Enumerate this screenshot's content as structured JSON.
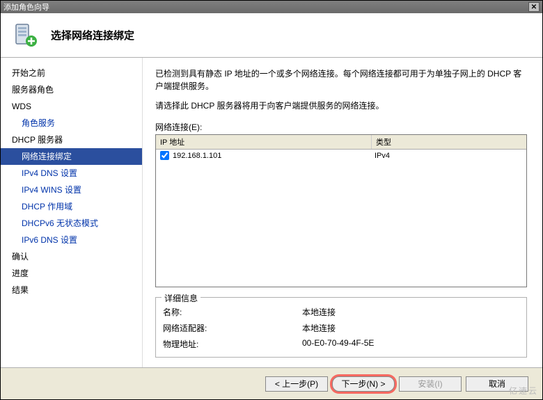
{
  "window": {
    "title": "添加角色向导"
  },
  "header": {
    "title": "选择网络连接绑定"
  },
  "sidebar": {
    "items": [
      {
        "label": "开始之前",
        "kind": "top"
      },
      {
        "label": "服务器角色",
        "kind": "top"
      },
      {
        "label": "WDS",
        "kind": "top"
      },
      {
        "label": "角色服务",
        "kind": "sub"
      },
      {
        "label": "DHCP 服务器",
        "kind": "top"
      },
      {
        "label": "网络连接绑定",
        "kind": "sub",
        "selected": true
      },
      {
        "label": "IPv4 DNS 设置",
        "kind": "sub"
      },
      {
        "label": "IPv4 WINS 设置",
        "kind": "sub"
      },
      {
        "label": "DHCP 作用域",
        "kind": "sub"
      },
      {
        "label": "DHCPv6 无状态模式",
        "kind": "sub"
      },
      {
        "label": "IPv6 DNS 设置",
        "kind": "sub"
      },
      {
        "label": "确认",
        "kind": "top"
      },
      {
        "label": "进度",
        "kind": "top"
      },
      {
        "label": "结果",
        "kind": "top"
      }
    ]
  },
  "main": {
    "description": "已检测到具有静态 IP 地址的一个或多个网络连接。每个网络连接都可用于为单独子网上的 DHCP 客户端提供服务。",
    "instruction": "请选择此 DHCP 服务器将用于向客户端提供服务的网络连接。",
    "list_label": "网络连接(E):",
    "columns": {
      "ip": "IP 地址",
      "type": "类型"
    },
    "rows": [
      {
        "checked": true,
        "ip": "192.168.1.101",
        "type": "IPv4"
      }
    ],
    "details": {
      "legend": "详细信息",
      "name_label": "名称:",
      "name_value": "本地连接",
      "adapter_label": "网络适配器:",
      "adapter_value": "本地连接",
      "mac_label": "物理地址:",
      "mac_value": "00-E0-70-49-4F-5E"
    }
  },
  "footer": {
    "prev": "< 上一步(P)",
    "next": "下一步(N) >",
    "install": "安装(I)",
    "cancel": "取消"
  },
  "watermark": "亿速云"
}
